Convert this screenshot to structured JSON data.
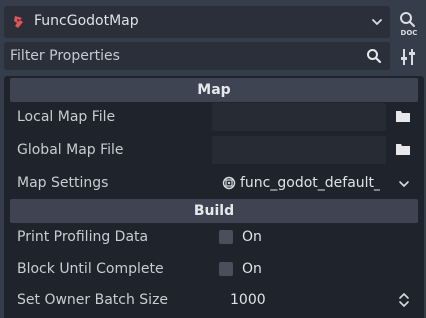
{
  "header": {
    "node_name": "FuncGodotMap",
    "node_icon": "funcgodot-map-icon",
    "accent_color": "#e0555a"
  },
  "filter": {
    "placeholder": "Filter Properties"
  },
  "sections": {
    "map": {
      "title": "Map",
      "local_map_file_label": "Local Map File",
      "local_map_file_value": "",
      "global_map_file_label": "Global Map File",
      "global_map_file_value": "",
      "map_settings_label": "Map Settings",
      "map_settings_value": "func_godot_default_"
    },
    "build": {
      "title": "Build",
      "print_profiling_label": "Print Profiling Data",
      "print_profiling_value": "On",
      "print_profiling_checked": false,
      "block_until_complete_label": "Block Until Complete",
      "block_until_complete_value": "On",
      "block_until_complete_checked": false,
      "owner_batch_size_label": "Set Owner Batch Size",
      "owner_batch_size_value": "1000"
    }
  }
}
